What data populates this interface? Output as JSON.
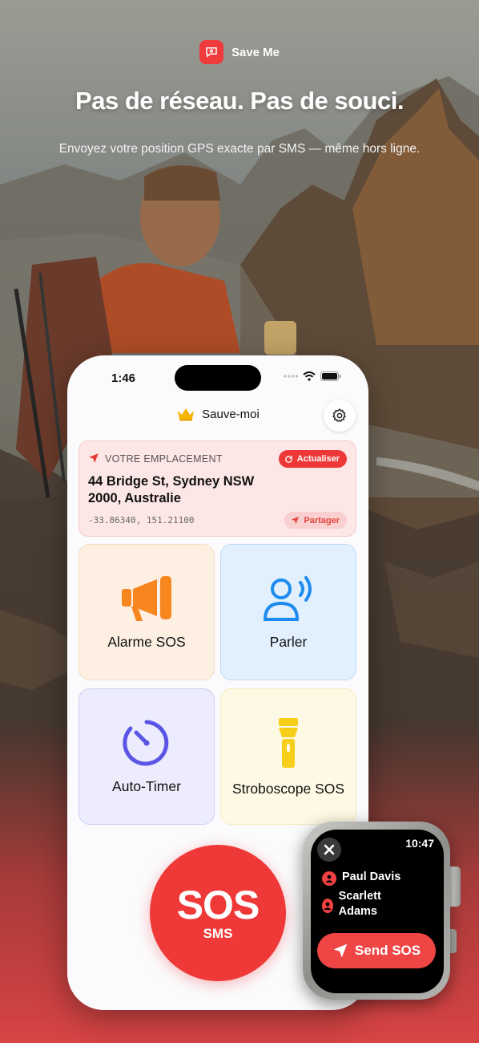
{
  "brand": {
    "name": "Save Me",
    "logo_icon": "chat-location-icon"
  },
  "hero": {
    "headline": "Pas de réseau. Pas de souci.",
    "subline": "Envoyez votre position GPS exacte par SMS — même hors ligne."
  },
  "phone": {
    "status": {
      "time": "1:46"
    },
    "app_title": "Sauve-moi",
    "location": {
      "label": "VOTRE EMPLACEMENT",
      "refresh_label": "Actualiser",
      "address": "44 Bridge St, Sydney NSW 2000, Australie",
      "coords": "-33.86340, 151.21100",
      "share_label": "Partager"
    },
    "tiles": {
      "alarm": {
        "label": "Alarme SOS",
        "icon": "megaphone-icon",
        "color": "#f7861f"
      },
      "speak": {
        "label": "Parler",
        "icon": "person-speaking-icon",
        "color": "#1e8bef"
      },
      "timer": {
        "label": "Auto-Timer",
        "icon": "timer-icon",
        "color": "#5b55e6"
      },
      "strobe": {
        "label": "Stroboscope SOS",
        "icon": "flashlight-icon",
        "color": "#f7cf1a"
      }
    },
    "sos": {
      "label": "SOS",
      "sub": "SMS",
      "color": "#ef3838"
    }
  },
  "watch": {
    "time": "10:47",
    "contacts": [
      {
        "name": "Paul Davis"
      },
      {
        "name": "Scarlett Adams"
      }
    ],
    "send_label": "Send SOS"
  }
}
